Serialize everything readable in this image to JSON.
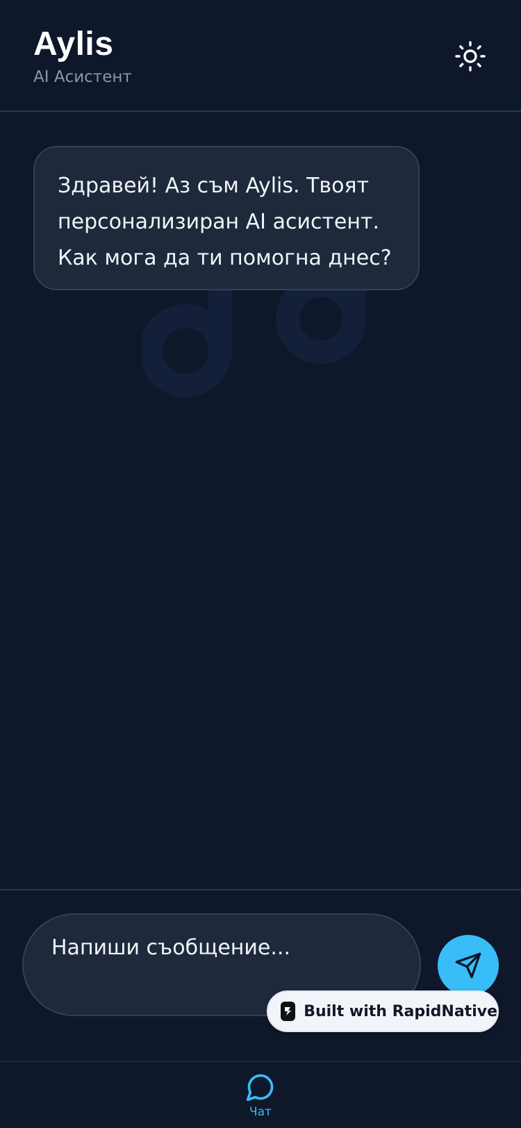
{
  "header": {
    "title": "Aylis",
    "subtitle": "AI Асистент",
    "theme_toggle_icon": "sun-icon"
  },
  "chat": {
    "messages": [
      {
        "role": "assistant",
        "lines": [
          "Здравей! Аз съм Aylis. Твоят",
          "персонализиран AI асистент.",
          "Как мога да ти помогна днес?"
        ]
      }
    ]
  },
  "input": {
    "placeholder": "Напиши съобщение...",
    "send_icon": "send-icon"
  },
  "badge": {
    "text": "Built with RapidNative"
  },
  "tabs": [
    {
      "label": "Чат",
      "icon": "chat-bubble-icon",
      "active": true
    }
  ],
  "colors": {
    "background": "#0f172a",
    "bubble": "#1e293b",
    "accent": "#38bdf8",
    "muted_text": "#8a97aa"
  }
}
